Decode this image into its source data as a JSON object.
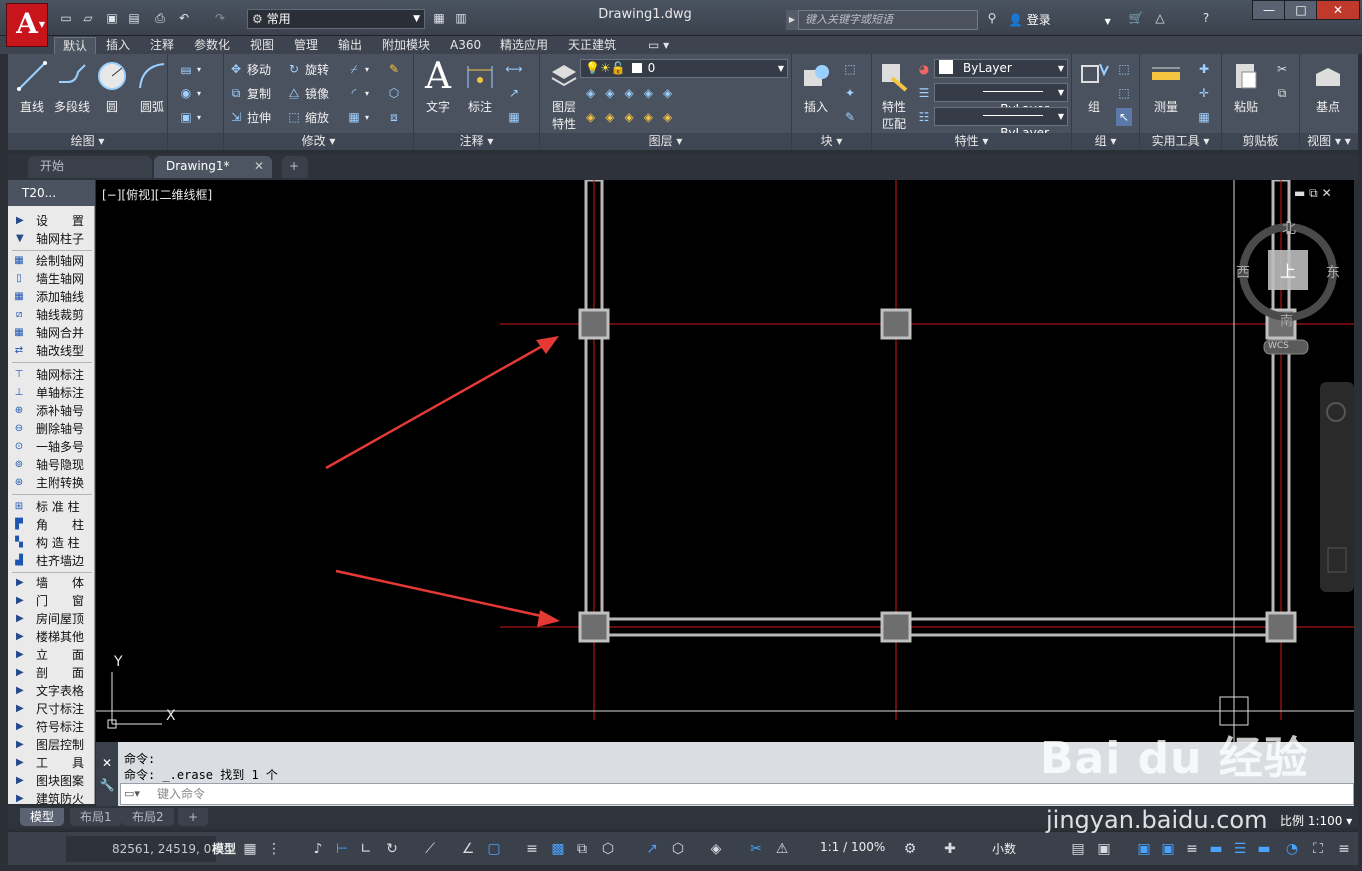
{
  "title_bar": {
    "app_logo": "A",
    "workspace": "常用",
    "document_title": "Drawing1.dwg",
    "search_placeholder": "键入关键字或短语",
    "login": "登录"
  },
  "ribbon_tabs": [
    "默认",
    "插入",
    "注释",
    "参数化",
    "视图",
    "管理",
    "输出",
    "附加模块",
    "A360",
    "精选应用",
    "天正建筑"
  ],
  "ribbon": {
    "draw": {
      "title": "绘图",
      "line": "直线",
      "polyline": "多段线",
      "circle": "圆",
      "arc": "圆弧"
    },
    "modify": {
      "title": "修改",
      "move": "移动",
      "rotate": "旋转",
      "copy": "复制",
      "mirror": "镜像",
      "stretch": "拉伸",
      "scale": "缩放"
    },
    "annotation": {
      "title": "注释",
      "text": "文字",
      "dimension": "标注"
    },
    "layers": {
      "title": "图层",
      "layer_props_line1": "图层",
      "layer_props_line2": "特性",
      "current_layer": "0"
    },
    "block": {
      "title": "块",
      "insert": "插入"
    },
    "properties": {
      "title": "特性",
      "match_line1": "特性",
      "match_line2": "匹配",
      "color": "ByLayer",
      "linetype": "ByLayer",
      "lineweight": "ByLayer"
    },
    "groups": {
      "title": "组",
      "group": "组"
    },
    "utilities": {
      "title": "实用工具",
      "measure": "测量"
    },
    "clipboard": {
      "title": "剪贴板",
      "paste": "粘贴"
    },
    "view": {
      "title": "视图",
      "base": "基点"
    }
  },
  "doc_tabs": {
    "start": "开始",
    "drawing": "Drawing1*"
  },
  "viewport_label": "[−][俯视][二维线框]",
  "viewcube": {
    "north": "北",
    "south": "南",
    "east": "东",
    "west": "西",
    "top": "上",
    "wcs": "WCS"
  },
  "ucs": {
    "x": "X",
    "y": "Y"
  },
  "left_panel": {
    "title": "T20...",
    "items": [
      {
        "label": "设　　置",
        "type": "collapsed"
      },
      {
        "label": "轴网柱子",
        "type": "expanded"
      },
      {
        "label": "绘制轴网",
        "type": "tool"
      },
      {
        "label": "墙生轴网",
        "type": "tool"
      },
      {
        "label": "添加轴线",
        "type": "tool"
      },
      {
        "label": "轴线裁剪",
        "type": "tool"
      },
      {
        "label": "轴网合并",
        "type": "tool"
      },
      {
        "label": "轴改线型",
        "type": "tool"
      },
      {
        "label": "轴网标注",
        "type": "tool"
      },
      {
        "label": "单轴标注",
        "type": "tool"
      },
      {
        "label": "添补轴号",
        "type": "tool"
      },
      {
        "label": "删除轴号",
        "type": "tool"
      },
      {
        "label": "一轴多号",
        "type": "tool"
      },
      {
        "label": "轴号隐现",
        "type": "tool"
      },
      {
        "label": "主附转换",
        "type": "tool"
      },
      {
        "label": "标 准 柱",
        "type": "tool"
      },
      {
        "label": "角　　柱",
        "type": "tool"
      },
      {
        "label": "构 造 柱",
        "type": "tool"
      },
      {
        "label": "柱齐墙边",
        "type": "tool"
      },
      {
        "label": "墙　　体",
        "type": "collapsed"
      },
      {
        "label": "门　　窗",
        "type": "collapsed"
      },
      {
        "label": "房间屋顶",
        "type": "collapsed"
      },
      {
        "label": "楼梯其他",
        "type": "collapsed"
      },
      {
        "label": "立　　面",
        "type": "collapsed"
      },
      {
        "label": "剖　　面",
        "type": "collapsed"
      },
      {
        "label": "文字表格",
        "type": "collapsed"
      },
      {
        "label": "尺寸标注",
        "type": "collapsed"
      },
      {
        "label": "符号标注",
        "type": "collapsed"
      },
      {
        "label": "图层控制",
        "type": "collapsed"
      },
      {
        "label": "工　　具",
        "type": "collapsed"
      },
      {
        "label": "图块图案",
        "type": "collapsed"
      },
      {
        "label": "建筑防火",
        "type": "collapsed"
      }
    ]
  },
  "command": {
    "history": [
      "命令:",
      "命令: _.erase 找到 1 个"
    ],
    "input_placeholder": "键入命令"
  },
  "layout_tabs": [
    "模型",
    "布局1",
    "布局2"
  ],
  "status_bar": {
    "coordinates": "82561, 24519, 0",
    "model": "模型",
    "annotation_scale": "1:1 / 100%",
    "units": "小数",
    "scale_label": "比例 1:100"
  },
  "watermark": {
    "brand": "Bai du 经验",
    "url": "jingyan.baidu.com"
  },
  "colors": {
    "accent_red": "#e02a2a",
    "grid_line": "#d01818",
    "wall": "#b8b8b8",
    "column": "#7a7a7a",
    "arrow": "#e53935"
  }
}
